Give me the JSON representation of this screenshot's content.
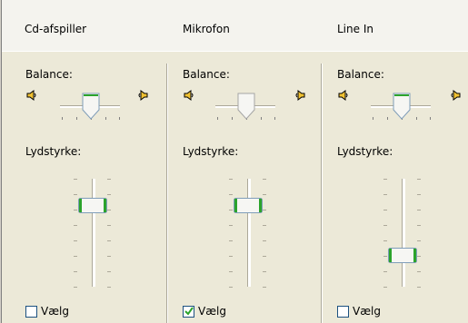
{
  "channels": [
    {
      "name": "Cd-afspiller",
      "balance_label": "Balance:",
      "volume_label": "Lydstyrke:",
      "balance": 0.5,
      "volume": 0.72,
      "select_label": "Vælg",
      "selected": false
    },
    {
      "name": "Mikrofon",
      "balance_label": "Balance:",
      "volume_label": "Lydstyrke:",
      "balance": 0.5,
      "volume": 0.72,
      "select_label": "Vælg",
      "selected": true
    },
    {
      "name": "Line In",
      "balance_label": "Balance:",
      "volume_label": "Lydstyrke:",
      "balance": 0.5,
      "volume": 0.18,
      "select_label": "Vælg",
      "selected": false
    }
  ],
  "colors": {
    "accent": "#2ba32b",
    "thumb_border": "#4d7b4d"
  }
}
